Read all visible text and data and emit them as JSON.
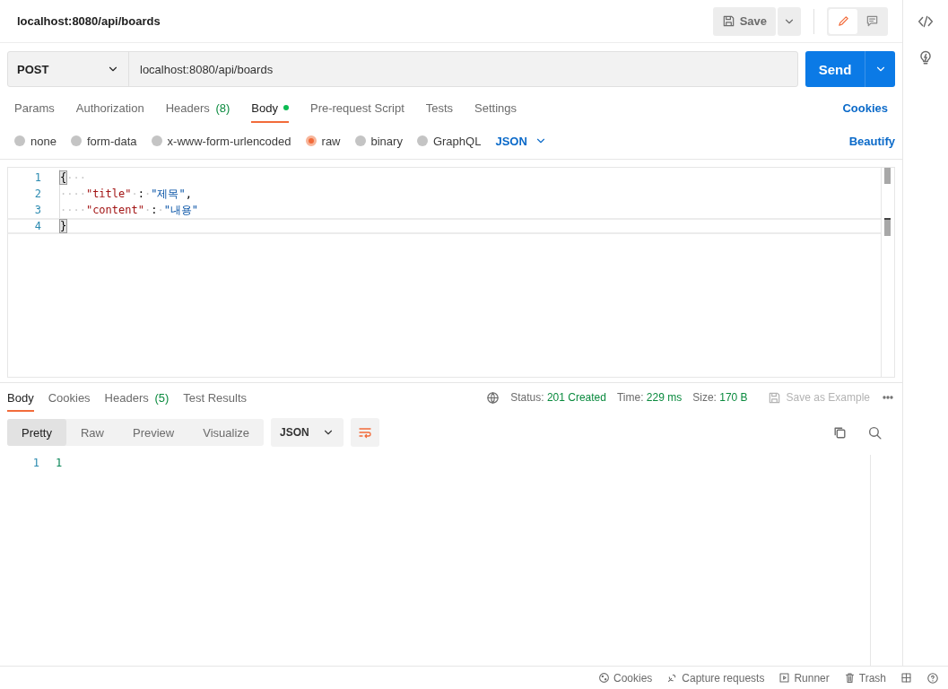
{
  "header": {
    "title": "localhost:8080/api/boards",
    "save_label": "Save"
  },
  "request": {
    "method": "POST",
    "url": "localhost:8080/api/boards",
    "send_label": "Send"
  },
  "mode_toggle": [
    {
      "kind": "edit",
      "selected": true
    },
    {
      "kind": "comment",
      "selected": false
    }
  ],
  "request_tabs": [
    {
      "label": "Params",
      "indicator": false,
      "selected": false
    },
    {
      "label": "Authorization",
      "indicator": false,
      "selected": false
    },
    {
      "label": "Headers",
      "count": "(8)",
      "indicator": false,
      "selected": false
    },
    {
      "label": "Body",
      "indicator": true,
      "selected": true
    },
    {
      "label": "Pre-request Script",
      "indicator": false,
      "selected": false
    },
    {
      "label": "Tests",
      "indicator": false,
      "selected": false
    },
    {
      "label": "Settings",
      "indicator": false,
      "selected": false
    }
  ],
  "cookies_link": "Cookies",
  "body_types": [
    {
      "label": "none",
      "selected": false
    },
    {
      "label": "form-data",
      "selected": false
    },
    {
      "label": "x-www-form-urlencoded",
      "selected": false
    },
    {
      "label": "raw",
      "selected": true
    },
    {
      "label": "binary",
      "selected": false
    },
    {
      "label": "GraphQL",
      "selected": false
    }
  ],
  "format": "JSON",
  "beautify_link": "Beautify",
  "editor": {
    "lines": [
      {
        "number": "1",
        "tokens": [
          {
            "kind": "bracket",
            "text": "{"
          },
          {
            "kind": "ws",
            "text": "···"
          }
        ]
      },
      {
        "number": "2",
        "tokens": [
          {
            "kind": "ws",
            "text": "····"
          },
          {
            "kind": "key",
            "text": "\"title\""
          },
          {
            "kind": "ws",
            "text": "·"
          },
          {
            "kind": "punct",
            "text": ":"
          },
          {
            "kind": "ws",
            "text": "·"
          },
          {
            "kind": "string",
            "text": "\"제목\""
          },
          {
            "kind": "punct",
            "text": ","
          }
        ]
      },
      {
        "number": "3",
        "tokens": [
          {
            "kind": "ws",
            "text": "····"
          },
          {
            "kind": "key",
            "text": "\"content\""
          },
          {
            "kind": "ws",
            "text": "·"
          },
          {
            "kind": "punct",
            "text": ":"
          },
          {
            "kind": "ws",
            "text": "·"
          },
          {
            "kind": "string",
            "text": "\"내용\""
          }
        ]
      },
      {
        "number": "4",
        "tokens": [
          {
            "kind": "bracket",
            "text": "}"
          }
        ]
      }
    ]
  },
  "response_tabs": [
    {
      "label": "Body",
      "selected": true
    },
    {
      "label": "Cookies",
      "selected": false
    },
    {
      "label": "Headers",
      "count": "(5)",
      "selected": false
    },
    {
      "label": "Test Results",
      "selected": false
    }
  ],
  "response_meta": [
    {
      "label": "Status:",
      "value": "201 Created"
    },
    {
      "label": "Time:",
      "value": "229 ms"
    },
    {
      "label": "Size:",
      "value": "170 B"
    }
  ],
  "save_example": "Save as Example",
  "view_modes": [
    {
      "label": "Pretty",
      "selected": true
    },
    {
      "label": "Raw",
      "selected": false
    },
    {
      "label": "Preview",
      "selected": false
    },
    {
      "label": "Visualize",
      "selected": false
    }
  ],
  "response_format": "JSON",
  "response_lines": [
    {
      "number": "1",
      "text": "1"
    }
  ],
  "status_bar": [
    {
      "kind": "cookie",
      "label": "Cookies"
    },
    {
      "kind": "capture",
      "label": "Capture requests"
    },
    {
      "kind": "runner",
      "label": "Runner"
    },
    {
      "kind": "trash",
      "label": "Trash"
    }
  ]
}
